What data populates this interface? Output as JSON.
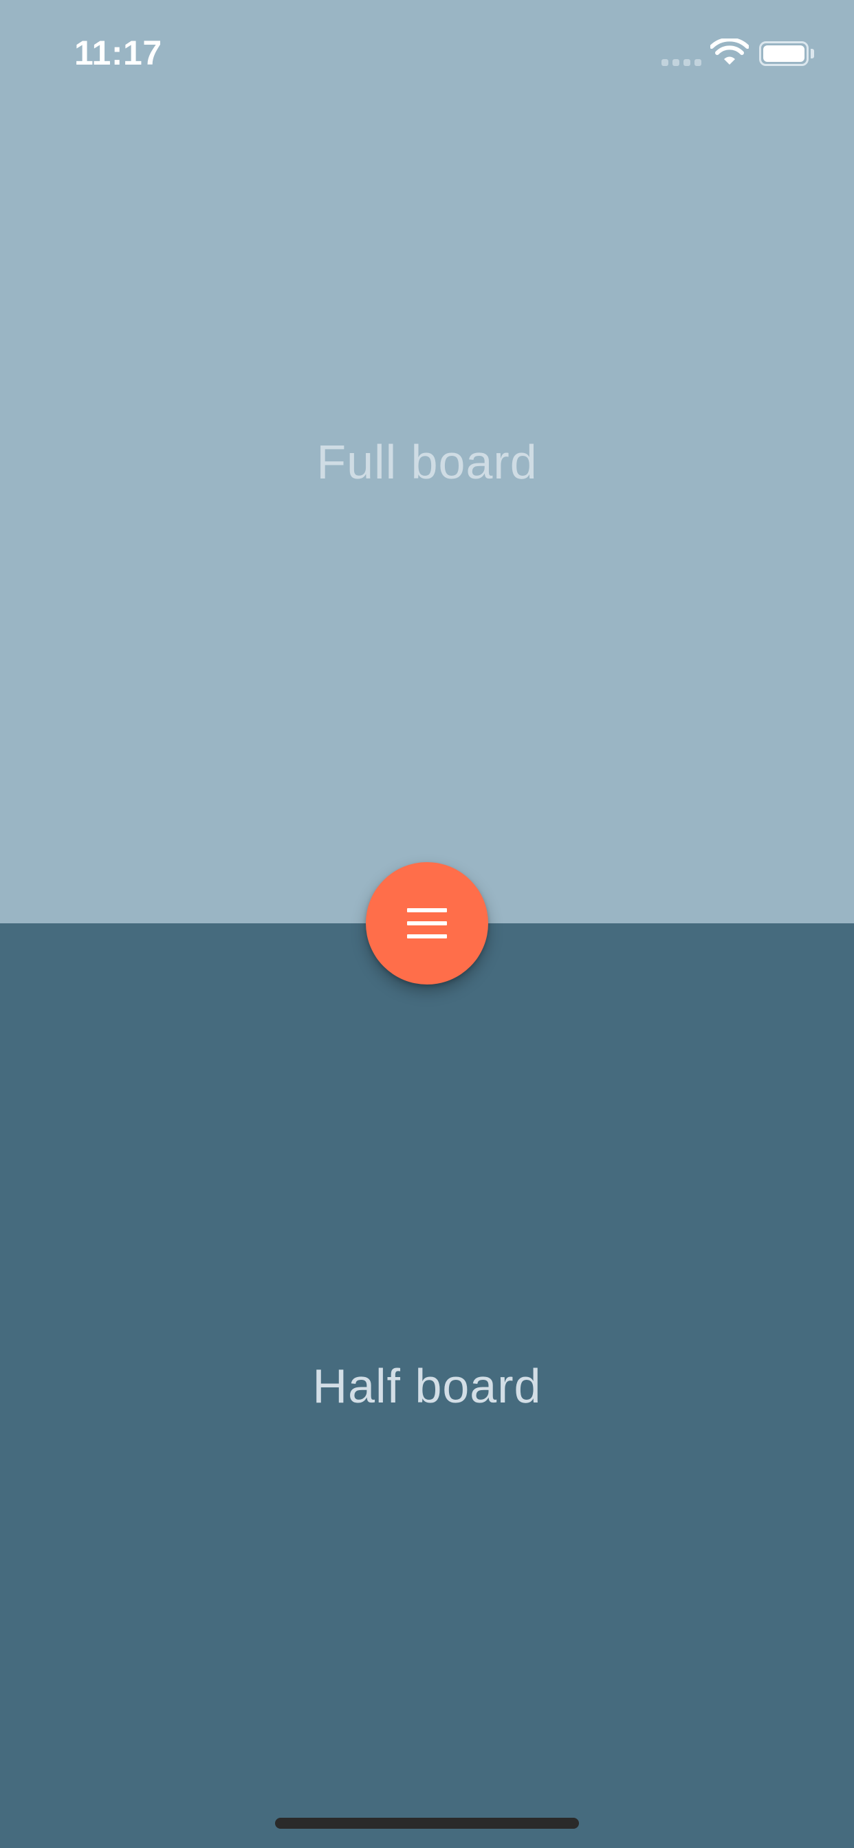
{
  "status_bar": {
    "time": "11:17",
    "signal_icon": "cellular-signal-icon",
    "wifi_icon": "wifi-icon",
    "battery_icon": "battery-icon",
    "battery_level": 1.0
  },
  "panels": {
    "top": {
      "label": "Full board",
      "color": "#9AB5C4"
    },
    "bottom": {
      "label": "Half board",
      "color": "#466B7E"
    }
  },
  "fab": {
    "icon": "menu-icon",
    "color": "#FF6E4A"
  }
}
